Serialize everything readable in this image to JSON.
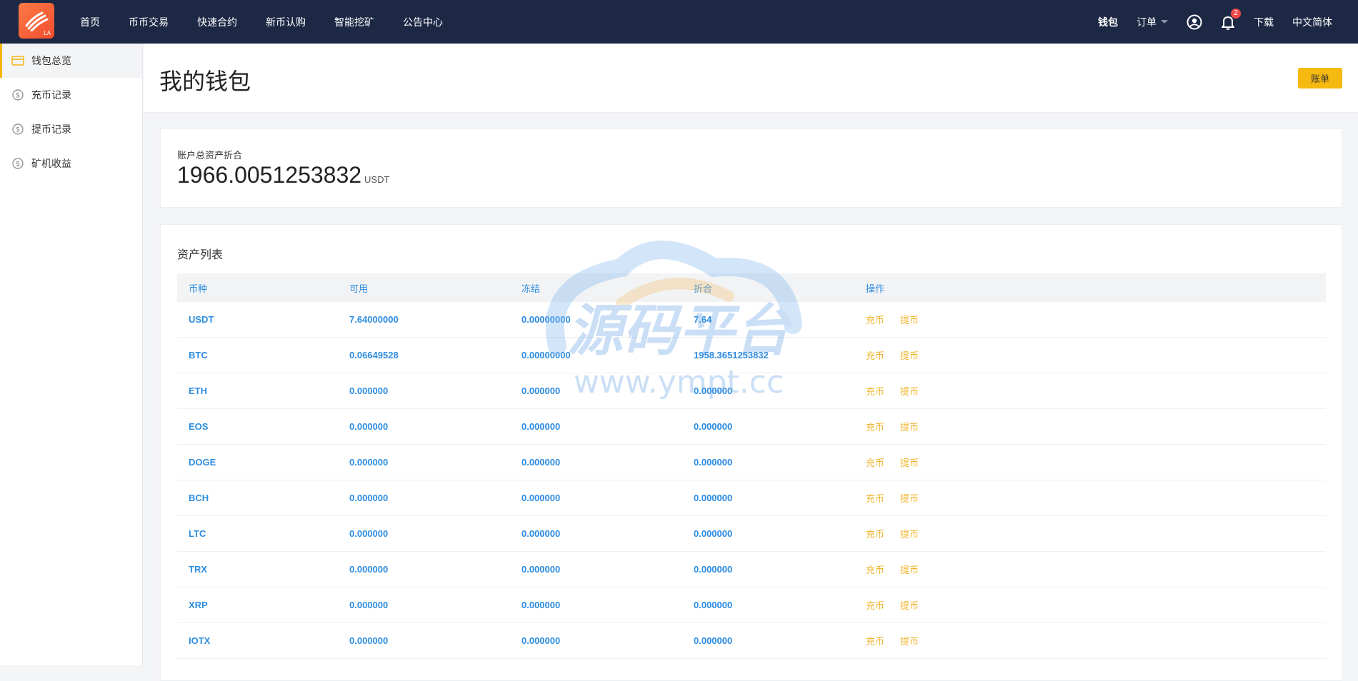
{
  "logo": {
    "text": "LA"
  },
  "nav": {
    "items": [
      "首页",
      "币币交易",
      "快速合约",
      "新币认购",
      "智能挖矿",
      "公告中心"
    ],
    "wallet": "钱包",
    "orders": "订单",
    "notification_count": "2",
    "download": "下载",
    "language": "中文简体"
  },
  "sidebar": {
    "items": [
      {
        "label": "钱包总览",
        "icon": "wallet-icon"
      },
      {
        "label": "充币记录",
        "icon": "dollar-icon"
      },
      {
        "label": "提币记录",
        "icon": "dollar-icon"
      },
      {
        "label": "矿机收益",
        "icon": "dollar-icon"
      }
    ]
  },
  "header": {
    "title": "我的钱包",
    "bill_button": "账单"
  },
  "total": {
    "label": "账户总资产折合",
    "value": "1966.0051253832",
    "unit": "USDT"
  },
  "assets": {
    "title": "资产列表",
    "columns": [
      "币种",
      "可用",
      "冻结",
      "折合",
      "操作"
    ],
    "deposit_label": "充币",
    "withdraw_label": "提币",
    "rows": [
      {
        "coin": "USDT",
        "available": "7.64000000",
        "frozen": "0.00000000",
        "value": "7.64"
      },
      {
        "coin": "BTC",
        "available": "0.06649528",
        "frozen": "0.00000000",
        "value": "1958.3651253832"
      },
      {
        "coin": "ETH",
        "available": "0.000000",
        "frozen": "0.000000",
        "value": "0.000000"
      },
      {
        "coin": "EOS",
        "available": "0.000000",
        "frozen": "0.000000",
        "value": "0.000000"
      },
      {
        "coin": "DOGE",
        "available": "0.000000",
        "frozen": "0.000000",
        "value": "0.000000"
      },
      {
        "coin": "BCH",
        "available": "0.000000",
        "frozen": "0.000000",
        "value": "0.000000"
      },
      {
        "coin": "LTC",
        "available": "0.000000",
        "frozen": "0.000000",
        "value": "0.000000"
      },
      {
        "coin": "TRX",
        "available": "0.000000",
        "frozen": "0.000000",
        "value": "0.000000"
      },
      {
        "coin": "XRP",
        "available": "0.000000",
        "frozen": "0.000000",
        "value": "0.000000"
      },
      {
        "coin": "IOTX",
        "available": "0.000000",
        "frozen": "0.000000",
        "value": "0.000000"
      }
    ]
  },
  "watermark": {
    "title": "源码平台",
    "url": "www.ympt.cc"
  },
  "colors": {
    "nav_bg": "#1d2845",
    "accent": "#f6b90f",
    "link": "#2d8ce0",
    "action": "#f0b428"
  }
}
